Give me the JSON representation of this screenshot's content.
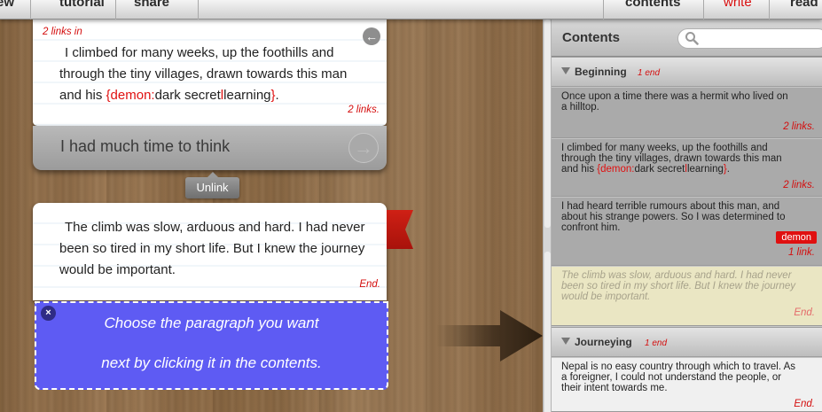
{
  "menu": {
    "items_left": [
      "ew",
      "tutorial",
      "share"
    ],
    "items_right": [
      "contents",
      "write",
      "read"
    ],
    "active": "write"
  },
  "editor": {
    "card1": {
      "links_in": "2 links in",
      "text_pre": "I climbed for many weeks, up the foothills and through the tiny villages, drawn towards this man and his ",
      "brace_open": "{demon:",
      "brace_mid": "dark secret",
      "brace_sep": "l",
      "brace_end": "learning",
      "brace_close": "}",
      "text_post": ".",
      "links_out": "2 links."
    },
    "link_bar": {
      "text": "I had much time to think"
    },
    "unlink_label": "Unlink",
    "card2": {
      "text": "The climb was slow, arduous and hard. I had never been so tired in my short life. But I knew the journey would be important.",
      "end_label": "End."
    },
    "choose": {
      "line1": "Choose the paragraph you want",
      "line2": "next by clicking it in the contents.",
      "close": "×"
    }
  },
  "contents": {
    "title": "Contents",
    "search_placeholder": "",
    "chapters": [
      {
        "name": "Beginning",
        "count": "1 end"
      },
      {
        "name": "Journeying",
        "count": "1 end"
      }
    ],
    "entries": [
      {
        "text": "Once upon a time there was a hermit who lived on a hilltop.",
        "links": "2 links."
      },
      {
        "text_pre": "I climbed for many weeks, up the foothills and through the tiny villages, drawn towards this man and his ",
        "brace_open": "{demon:",
        "brace_mid": "dark secret",
        "brace_sep": "l",
        "brace_end": "learning",
        "brace_close": "}",
        "text_post": ".",
        "links": "2 links."
      },
      {
        "text": "I had heard terrible rumours about this man, and about his strange powers. So I was determined to confront him.",
        "tag": "demon",
        "links": "1 link."
      },
      {
        "text": "The climb was slow, arduous and hard. I had never been so tired in my short life. But I knew the journey would be important.",
        "links": "End."
      },
      {
        "text": "Nepal is no easy country through which to travel. As a foreigner, I could not understand the people, or their intent towards me.",
        "links": "End."
      }
    ]
  },
  "colors": {
    "accent_red": "#e01010",
    "choose_blue": "#5e5bf3",
    "highlight": "#eae6c3"
  }
}
